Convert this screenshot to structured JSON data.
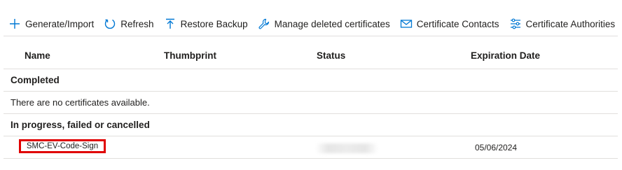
{
  "toolbar": {
    "buttons": [
      {
        "label": "Generate/Import",
        "icon": "plus-icon"
      },
      {
        "label": "Refresh",
        "icon": "refresh-icon"
      },
      {
        "label": "Restore Backup",
        "icon": "upload-arrow-icon"
      },
      {
        "label": "Manage deleted certificates",
        "icon": "wrench-icon"
      },
      {
        "label": "Certificate Contacts",
        "icon": "mail-icon"
      },
      {
        "label": "Certificate Authorities",
        "icon": "sliders-icon"
      }
    ]
  },
  "grid": {
    "columns": [
      "Name",
      "Thumbprint",
      "Status",
      "Expiration Date"
    ],
    "groups": [
      {
        "title": "Completed",
        "empty_message": "There are no certificates available.",
        "rows": []
      },
      {
        "title": "In progress, failed or cancelled",
        "rows": [
          {
            "name": "SMC-EV-Code-Sign",
            "thumbprint": "",
            "status": "",
            "expiration": "05/06/2024"
          }
        ]
      }
    ]
  },
  "colors": {
    "accent": "#0078d4",
    "highlight": "#e00000",
    "divider": "#e1dfdd"
  }
}
